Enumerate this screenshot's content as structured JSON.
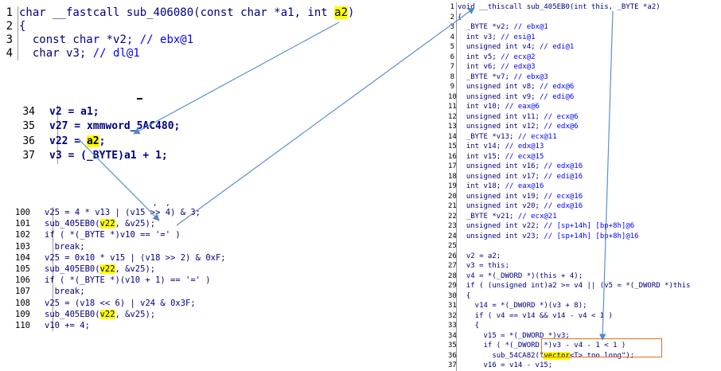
{
  "block_a": [
    {
      "n": "1",
      "segs": [
        {
          "t": "char __fastcall sub_406080(const char *a1, int ",
          "c": "k"
        },
        {
          "t": "a2",
          "c": "hl"
        },
        {
          "t": ")",
          "c": "k"
        }
      ]
    },
    {
      "n": "2",
      "segs": [
        {
          "t": "{",
          "c": "k"
        }
      ]
    },
    {
      "n": "3",
      "segs": [
        {
          "t": "  const char *",
          "c": "k"
        },
        {
          "t": "v2",
          "c": "v"
        },
        {
          "t": "; // ebx@1",
          "c": "c"
        }
      ]
    },
    {
      "n": "4",
      "segs": [
        {
          "t": "  char ",
          "c": "k"
        },
        {
          "t": "v3",
          "c": "v"
        },
        {
          "t": "; // dl@1",
          "c": "c"
        }
      ]
    }
  ],
  "block_b": [
    {
      "n": "34",
      "segs": [
        {
          "t": "v2",
          "c": "v"
        },
        {
          "t": " = ",
          "c": "k"
        },
        {
          "t": "a1",
          "c": "v"
        },
        {
          "t": ";",
          "c": "k"
        }
      ]
    },
    {
      "n": "35",
      "segs": [
        {
          "t": "v27",
          "c": "v"
        },
        {
          "t": " = xmmword_5AC480;",
          "c": "k"
        }
      ]
    },
    {
      "n": "36",
      "segs": [
        {
          "t": "v22",
          "c": "v"
        },
        {
          "t": " = ",
          "c": "k"
        },
        {
          "t": "a2",
          "c": "hl"
        },
        {
          "t": ";",
          "c": "k"
        }
      ]
    },
    {
      "n": "37",
      "segs": [
        {
          "t": "v3",
          "c": "v"
        },
        {
          "t": " = (_BYTE)",
          "c": "k"
        },
        {
          "t": "a1",
          "c": "v"
        },
        {
          "t": " + 1;",
          "c": "k"
        }
      ]
    }
  ],
  "block_c": [
    {
      "n": "100",
      "segs": [
        {
          "t": "v25",
          "c": "v"
        },
        {
          "t": " = 4 * ",
          "c": "k"
        },
        {
          "t": "v13",
          "c": "v"
        },
        {
          "t": " | (",
          "c": "k"
        },
        {
          "t": "v15",
          "c": "v"
        },
        {
          "t": " >> 4) & 3;",
          "c": "k"
        }
      ]
    },
    {
      "n": "101",
      "segs": [
        {
          "t": "sub_405EB0(",
          "c": "k"
        },
        {
          "t": "v22",
          "c": "hl"
        },
        {
          "t": ", &",
          "c": "k"
        },
        {
          "t": "v25",
          "c": "v"
        },
        {
          "t": ");",
          "c": "k"
        }
      ]
    },
    {
      "n": "102",
      "segs": [
        {
          "t": "if ( *(_BYTE *)",
          "c": "k"
        },
        {
          "t": "v10",
          "c": "v"
        },
        {
          "t": " == '=' )",
          "c": "k"
        }
      ]
    },
    {
      "n": "103",
      "segs": [
        {
          "t": "  break;",
          "c": "k"
        }
      ]
    },
    {
      "n": "104",
      "segs": [
        {
          "t": "v25",
          "c": "v"
        },
        {
          "t": " = 0x10 * ",
          "c": "k"
        },
        {
          "t": "v15",
          "c": "v"
        },
        {
          "t": " | (",
          "c": "k"
        },
        {
          "t": "v18",
          "c": "v"
        },
        {
          "t": " >> 2) & 0xF;",
          "c": "k"
        }
      ]
    },
    {
      "n": "105",
      "segs": [
        {
          "t": "sub_405EB0(",
          "c": "k"
        },
        {
          "t": "v22",
          "c": "hl"
        },
        {
          "t": ", &",
          "c": "k"
        },
        {
          "t": "v25",
          "c": "v"
        },
        {
          "t": ");",
          "c": "k"
        }
      ]
    },
    {
      "n": "106",
      "segs": [
        {
          "t": "if ( *(_BYTE *)(",
          "c": "k"
        },
        {
          "t": "v10",
          "c": "v"
        },
        {
          "t": " + 1) == '=' )",
          "c": "k"
        }
      ]
    },
    {
      "n": "107",
      "segs": [
        {
          "t": "  break;",
          "c": "k"
        }
      ]
    },
    {
      "n": "108",
      "segs": [
        {
          "t": "v25",
          "c": "v"
        },
        {
          "t": " = (",
          "c": "k"
        },
        {
          "t": "v18",
          "c": "v"
        },
        {
          "t": " << 6) | ",
          "c": "k"
        },
        {
          "t": "v24",
          "c": "v"
        },
        {
          "t": " & 0x3F;",
          "c": "k"
        }
      ]
    },
    {
      "n": "109",
      "segs": [
        {
          "t": "sub_405EB0(",
          "c": "k"
        },
        {
          "t": "v22",
          "c": "hl"
        },
        {
          "t": ", &",
          "c": "k"
        },
        {
          "t": "v25",
          "c": "v"
        },
        {
          "t": ");",
          "c": "k"
        }
      ]
    },
    {
      "n": "110",
      "segs": [
        {
          "t": "v10",
          "c": "v"
        },
        {
          "t": " += 4;",
          "c": "k"
        }
      ]
    }
  ],
  "block_d": [
    {
      "n": "1",
      "segs": [
        {
          "t": "void __thiscall sub_405EB0(int this, _BYTE *a2)",
          "c": "k"
        }
      ]
    },
    {
      "n": "2",
      "segs": [
        {
          "t": "{",
          "c": "k"
        }
      ]
    },
    {
      "n": "3",
      "segs": [
        {
          "t": "  _BYTE *v2; ",
          "c": "k"
        },
        {
          "t": "// ebx@1",
          "c": "c"
        }
      ]
    },
    {
      "n": "4",
      "segs": [
        {
          "t": "  int v3; ",
          "c": "k"
        },
        {
          "t": "// esi@1",
          "c": "c"
        }
      ]
    },
    {
      "n": "5",
      "segs": [
        {
          "t": "  unsigned int v4; ",
          "c": "k"
        },
        {
          "t": "// edi@1",
          "c": "c"
        }
      ]
    },
    {
      "n": "6",
      "segs": [
        {
          "t": "  int v5; ",
          "c": "k"
        },
        {
          "t": "// ecx@2",
          "c": "c"
        }
      ]
    },
    {
      "n": "7",
      "segs": [
        {
          "t": "  int v6; ",
          "c": "k"
        },
        {
          "t": "// edx@3",
          "c": "c"
        }
      ]
    },
    {
      "n": "8",
      "segs": [
        {
          "t": "  _BYTE *v7; ",
          "c": "k"
        },
        {
          "t": "// ebx@3",
          "c": "c"
        }
      ]
    },
    {
      "n": "9",
      "segs": [
        {
          "t": "  unsigned int v8; ",
          "c": "k"
        },
        {
          "t": "// edx@6",
          "c": "c"
        }
      ]
    },
    {
      "n": "10",
      "segs": [
        {
          "t": "  unsigned int v9; ",
          "c": "k"
        },
        {
          "t": "// edi@6",
          "c": "c"
        }
      ]
    },
    {
      "n": "11",
      "segs": [
        {
          "t": "  int v10; ",
          "c": "k"
        },
        {
          "t": "// eax@6",
          "c": "c"
        }
      ]
    },
    {
      "n": "12",
      "segs": [
        {
          "t": "  unsigned int v11; ",
          "c": "k"
        },
        {
          "t": "// ecx@6",
          "c": "c"
        }
      ]
    },
    {
      "n": "13",
      "segs": [
        {
          "t": "  unsigned int v12; ",
          "c": "k"
        },
        {
          "t": "// edx@6",
          "c": "c"
        }
      ]
    },
    {
      "n": "14",
      "segs": [
        {
          "t": "  _BYTE *v13; ",
          "c": "k"
        },
        {
          "t": "// ecx@11",
          "c": "c"
        }
      ]
    },
    {
      "n": "15",
      "segs": [
        {
          "t": "  int v14; ",
          "c": "k"
        },
        {
          "t": "// edx@13",
          "c": "c"
        }
      ]
    },
    {
      "n": "16",
      "segs": [
        {
          "t": "  int v15; ",
          "c": "k"
        },
        {
          "t": "// ecx@15",
          "c": "c"
        }
      ]
    },
    {
      "n": "17",
      "segs": [
        {
          "t": "  unsigned int v16; ",
          "c": "k"
        },
        {
          "t": "// edx@16",
          "c": "c"
        }
      ]
    },
    {
      "n": "18",
      "segs": [
        {
          "t": "  unsigned int v17; ",
          "c": "k"
        },
        {
          "t": "// edi@16",
          "c": "c"
        }
      ]
    },
    {
      "n": "19",
      "segs": [
        {
          "t": "  int v18; ",
          "c": "k"
        },
        {
          "t": "// eax@16",
          "c": "c"
        }
      ]
    },
    {
      "n": "20",
      "segs": [
        {
          "t": "  unsigned int v19; ",
          "c": "k"
        },
        {
          "t": "// ecx@16",
          "c": "c"
        }
      ]
    },
    {
      "n": "21",
      "segs": [
        {
          "t": "  unsigned int v20; ",
          "c": "k"
        },
        {
          "t": "// edx@16",
          "c": "c"
        }
      ]
    },
    {
      "n": "22",
      "segs": [
        {
          "t": "  _BYTE *v21; ",
          "c": "k"
        },
        {
          "t": "// ecx@21",
          "c": "c"
        }
      ]
    },
    {
      "n": "23",
      "segs": [
        {
          "t": "  unsigned int v22; ",
          "c": "k"
        },
        {
          "t": "// [sp+14h] [bp+8h]@6",
          "c": "c"
        }
      ]
    },
    {
      "n": "24",
      "segs": [
        {
          "t": "  unsigned int v23; ",
          "c": "k"
        },
        {
          "t": "// [sp+14h] [bp+8h]@16",
          "c": "c"
        }
      ]
    },
    {
      "n": "25",
      "segs": [
        {
          "t": "",
          "c": "k"
        }
      ]
    },
    {
      "n": "26",
      "segs": [
        {
          "t": "  v2 = a2;",
          "c": "k"
        }
      ]
    },
    {
      "n": "27",
      "segs": [
        {
          "t": "  v3 = this;",
          "c": "k"
        }
      ]
    },
    {
      "n": "28",
      "segs": [
        {
          "t": "  v4 = *(_DWORD *)(this + 4);",
          "c": "k"
        }
      ]
    },
    {
      "n": "29",
      "segs": [
        {
          "t": "  if ( (unsigned int)a2 >= v4 || (v5 = *(_DWORD *)this",
          "c": "k"
        }
      ]
    },
    {
      "n": "30",
      "segs": [
        {
          "t": "  {",
          "c": "k"
        }
      ]
    },
    {
      "n": "31",
      "segs": [
        {
          "t": "    v14 = *(_DWORD *)(v3 + 8);",
          "c": "k"
        }
      ]
    },
    {
      "n": "32",
      "segs": [
        {
          "t": "    if ( v4 == v14 && v14 - v4 < 1 )",
          "c": "k"
        }
      ]
    },
    {
      "n": "33",
      "segs": [
        {
          "t": "    {",
          "c": "k"
        }
      ]
    },
    {
      "n": "34",
      "segs": [
        {
          "t": "      v15 = *(_DWORD *)v3;",
          "c": "k"
        }
      ]
    },
    {
      "n": "35",
      "segs": [
        {
          "t": "      if ( *(_DWORD *)v3 - v4 - 1 < 1 )",
          "c": "k"
        }
      ]
    },
    {
      "n": "36",
      "segs": [
        {
          "t": "        sub_54CA82(\"",
          "c": "k"
        },
        {
          "t": "vector",
          "c": "hl"
        },
        {
          "t": "<T> too long\");",
          "c": "k"
        }
      ]
    },
    {
      "n": "37",
      "segs": [
        {
          "t": "      v16 = v14 - v15;",
          "c": "k"
        }
      ]
    }
  ],
  "fragment_cursor": ",  ,"
}
